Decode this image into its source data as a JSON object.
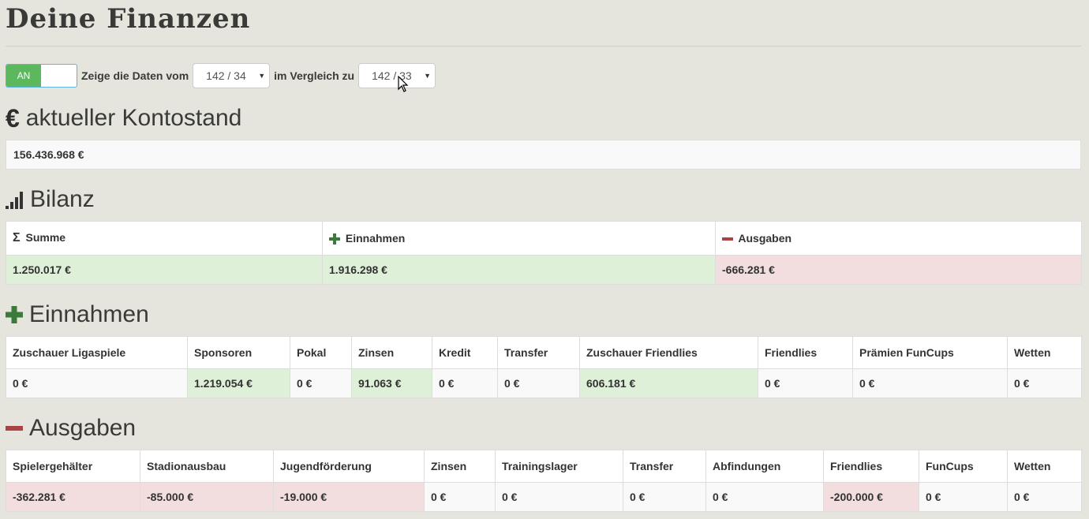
{
  "page": {
    "title": "Deine Finanzen"
  },
  "toolbar": {
    "toggle_label": "AN",
    "show_label": "Zeige die Daten vom",
    "season_selected": "142 / 34",
    "compare_label": "im Vergleich zu",
    "compare_selected": "142 / 33"
  },
  "kontostand": {
    "heading_symbol": "€",
    "heading": "aktueller Kontostand",
    "value": "156.436.968 €"
  },
  "bilanz": {
    "heading": "Bilanz",
    "headers": {
      "sum_symbol": "Σ",
      "sum": "Summe",
      "income": "Einnahmen",
      "expenses": "Ausgaben"
    },
    "values": {
      "sum": "1.250.017 €",
      "income": "1.916.298 €",
      "expenses": "-666.281 €"
    }
  },
  "einnahmen": {
    "heading": "Einnahmen",
    "headers": [
      "Zuschauer Ligaspiele",
      "Sponsoren",
      "Pokal",
      "Zinsen",
      "Kredit",
      "Transfer",
      "Zuschauer Friendlies",
      "Friendlies",
      "Prämien FunCups",
      "Wetten"
    ],
    "values": [
      "0 €",
      "1.219.054 €",
      "0 €",
      "91.063 €",
      "0 €",
      "0 €",
      "606.181 €",
      "0 €",
      "0 €",
      "0 €"
    ]
  },
  "ausgaben": {
    "heading": "Ausgaben",
    "headers": [
      "Spielergehälter",
      "Stadionausbau",
      "Jugendförderung",
      "Zinsen",
      "Trainingslager",
      "Transfer",
      "Abfindungen",
      "Friendlies",
      "FunCups",
      "Wetten"
    ],
    "values": [
      "-362.281 €",
      "-85.000 €",
      "-19.000 €",
      "0 €",
      "0 €",
      "0 €",
      "0 €",
      "-200.000 €",
      "0 €",
      "0 €"
    ]
  },
  "colors": {
    "positive_bg": "#dff0d8",
    "negative_bg": "#f2dede",
    "plus_green": "#3c7a3c",
    "minus_red": "#a94442",
    "toggle_green": "#5cb85c"
  }
}
